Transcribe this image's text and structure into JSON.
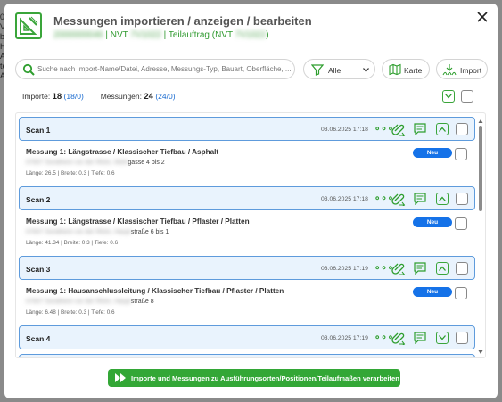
{
  "background": {
    "edge_text": [
      "02",
      "V",
      "bi",
      "H",
      "A",
      "te",
      "A"
    ]
  },
  "dialog": {
    "title": "Messungen importieren / anzeigen / bearbeiten",
    "subtitle": {
      "redacted_id": "2000000046",
      "nvt_label": "| NVT",
      "nvt_value": "7V1022",
      "teil_label": "| Teilauftrag (NVT",
      "teil_value": "7V1022",
      "close_paren": ")"
    }
  },
  "toolbar": {
    "search_placeholder": "Suche nach Import-Name/Datei, Adresse, Messungs-Typ, Bauart, Oberfläche, ...",
    "filter_value": "Alle",
    "map_label": "Karte",
    "import_label": "Import"
  },
  "counts": {
    "imports_label": "Importe:",
    "imports_total": "18",
    "imports_detail_open": "(",
    "imports_detail_a": "18",
    "imports_detail_sep": "/",
    "imports_detail_b": "0",
    "imports_detail_close": ")",
    "measurements_label": "Messungen:",
    "measurements_total": "24",
    "measurements_detail_a": "24",
    "measurements_detail_b": "0"
  },
  "scans": [
    {
      "name": "Scan 1",
      "date": "03.06.2025 17:18",
      "measurement": {
        "title": "Messung 1: Längstrasse / Klassischer Tiefbau / Asphalt",
        "address_redacted": "07937 Sondheim vor der Rhön, Mühl",
        "address_visible": "gasse 4 bis 2",
        "details": "Länge: 26.5 | Breite: 0.3 | Tiefe: 0.6",
        "badge": "Neu"
      }
    },
    {
      "name": "Scan 2",
      "date": "03.06.2025 17:18",
      "measurement": {
        "title": "Messung 1: Längstrasse / Klassischer Tiefbau / Pflaster / Platten",
        "address_redacted": "07937 Sondheim vor der Rhön, Haupt",
        "address_visible": "straße 6 bis 1",
        "details": "Länge: 41.34 | Breite: 0.3 | Tiefe: 0.6",
        "badge": "Neu"
      }
    },
    {
      "name": "Scan 3",
      "date": "03.06.2025 17:19",
      "measurement": {
        "title": "Messung 1: Hausanschlussleitung / Klassischer Tiefbau / Pflaster / Platten",
        "address_redacted": "07937 Sondheim vor der Rhön, Haupt",
        "address_visible": "straße 8",
        "details": "Länge: 6.48 | Breite: 0.3 | Tiefe: 0.6",
        "badge": "Neu"
      }
    },
    {
      "name": "Scan 4",
      "date": "03.06.2025 17:19"
    }
  ],
  "footer": {
    "process_label": "Importe und Messungen zu Ausführungsorten/Positionen/Teilaufmaßen verarbeiten"
  },
  "colors": {
    "accent_green": "#33a736",
    "badge_blue": "#1572e8",
    "scan_bg": "#e9f3fd",
    "scan_border": "#5e9bdc"
  },
  "icons": [
    "app-logo-icon",
    "close-icon",
    "search-icon",
    "filter-icon",
    "chevron-down-icon",
    "map-icon",
    "import-icon",
    "more-dots-icon",
    "attachment-icon",
    "comment-icon",
    "chevron-up-icon",
    "forward-icon"
  ]
}
